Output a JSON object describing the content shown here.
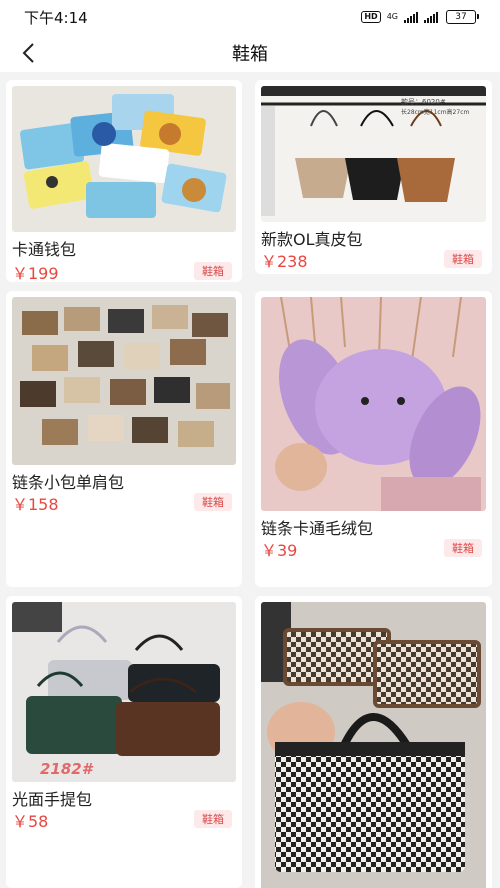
{
  "status": {
    "time": "下午4:14",
    "hd": "HD",
    "network": "4G",
    "battery": "37"
  },
  "header": {
    "title": "鞋箱"
  },
  "products": [
    {
      "name": "卡通钱包",
      "price": "￥199",
      "tag": "鞋箱"
    },
    {
      "name": "新款OL真皮包",
      "price": "￥238",
      "tag": "鞋箱"
    },
    {
      "name": "链条小包单肩包",
      "price": "￥158",
      "tag": "鞋箱"
    },
    {
      "name": "链条卡通毛绒包",
      "price": "￥39",
      "tag": "鞋箱"
    },
    {
      "name": "光面手提包",
      "price": "￥58",
      "tag": "鞋箱"
    },
    {
      "name": "",
      "price": "",
      "tag": ""
    }
  ],
  "image_text": {
    "bag2_model": "款号：6020#",
    "bag2_size": "长28cm宽11cm高27cm",
    "bag5_code": "2182#"
  },
  "colors": {
    "price": "#e8483f",
    "tag_bg": "#fde9ea",
    "tag_text": "#d84a4a"
  }
}
